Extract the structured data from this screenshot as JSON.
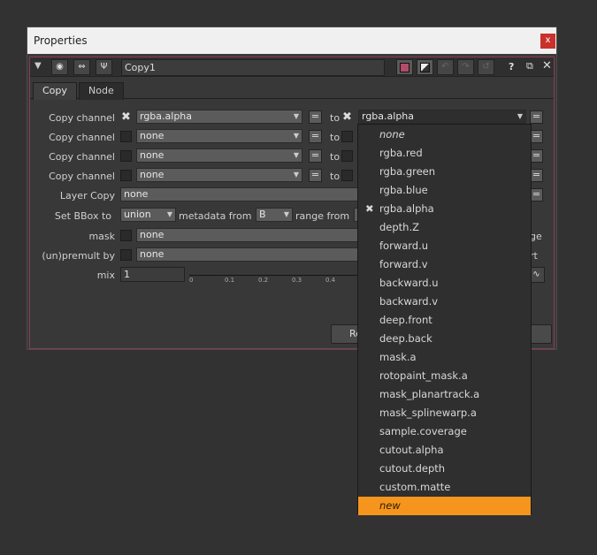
{
  "window": {
    "title": "Properties",
    "close": "x"
  },
  "node": {
    "name": "Copy1",
    "help": "?"
  },
  "tabs": [
    "Copy",
    "Node"
  ],
  "copy_rows": [
    {
      "label": "Copy channel",
      "from": "rgba.alpha",
      "to_label": "to",
      "to": "rgba.alpha"
    },
    {
      "label": "Copy channel",
      "from": "none",
      "to_label": "to"
    },
    {
      "label": "Copy channel",
      "from": "none",
      "to_label": "to"
    },
    {
      "label": "Copy channel",
      "from": "none",
      "to_label": "to"
    }
  ],
  "eq": "=",
  "layer_copy": {
    "label": "Layer Copy",
    "value": "none"
  },
  "bbox": {
    "label": "Set BBox to",
    "value": "union",
    "metadata_label": "metadata from",
    "metadata_value": "B",
    "range_label": "range from"
  },
  "mask": {
    "label": "mask",
    "value": "none",
    "suffix": "ge"
  },
  "premult": {
    "label": "(un)premult by",
    "value": "none",
    "suffix": "rt"
  },
  "mix": {
    "label": "mix",
    "value": "1",
    "ticks": [
      "0",
      "0.1",
      "0.2",
      "0.3",
      "0.4"
    ]
  },
  "footer": {
    "button_partial": "Re"
  },
  "channel_menu": [
    {
      "label": "none",
      "style": "italic"
    },
    {
      "label": "rgba.red"
    },
    {
      "label": "rgba.green"
    },
    {
      "label": "rgba.blue"
    },
    {
      "label": "rgba.alpha",
      "checked": true
    },
    {
      "label": "depth.Z"
    },
    {
      "label": "forward.u"
    },
    {
      "label": "forward.v"
    },
    {
      "label": "backward.u"
    },
    {
      "label": "backward.v"
    },
    {
      "label": "deep.front"
    },
    {
      "label": "deep.back"
    },
    {
      "label": "mask.a"
    },
    {
      "label": "rotopaint_mask.a"
    },
    {
      "label": "mask_planartrack.a"
    },
    {
      "label": "mask_splinewarp.a"
    },
    {
      "label": "sample.coverage"
    },
    {
      "label": "cutout.alpha"
    },
    {
      "label": "cutout.depth"
    },
    {
      "label": "custom.matte"
    },
    {
      "label": "new",
      "style": "italic",
      "highlighted": true
    }
  ],
  "colors": {
    "accent": "#f5951d",
    "panel_border": "#8a3c52",
    "close": "#c9302c"
  }
}
